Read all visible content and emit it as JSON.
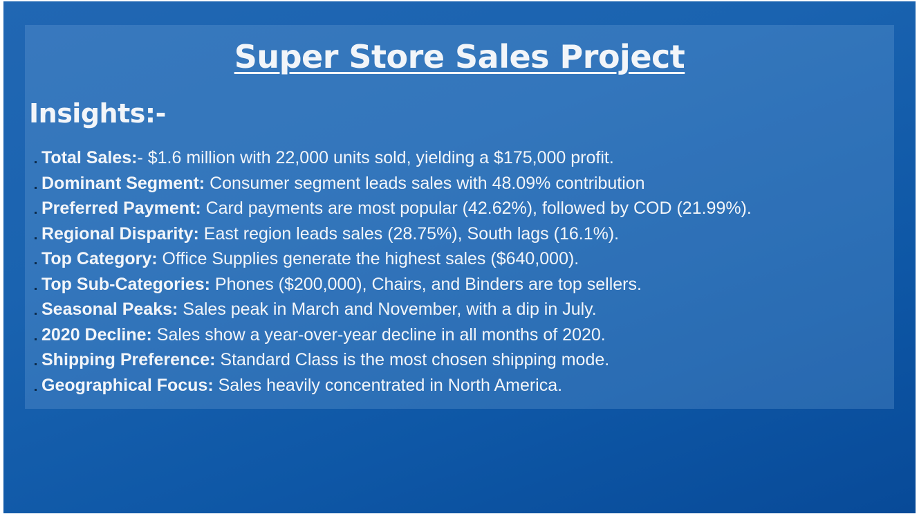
{
  "page": {
    "title": "Super Store Sales Project",
    "subtitle": "Insights:-"
  },
  "insights": [
    {
      "label": "Total Sales:",
      "text": "- $1.6 million with 22,000 units sold, yielding a $175,000 profit."
    },
    {
      "label": "Dominant Segment:",
      "text": " Consumer segment leads sales with 48.09% contribution"
    },
    {
      "label": "Preferred Payment:",
      "text": " Card payments are most popular (42.62%), followed by COD (21.99%)."
    },
    {
      "label": "Regional Disparity:",
      "text": " East region leads sales (28.75%), South lags (16.1%)."
    },
    {
      "label": "Top Category:",
      "text": " Office Supplies generate the highest sales ($640,000)."
    },
    {
      "label": "Top Sub-Categories:",
      "text": " Phones ($200,000), Chairs, and Binders are top sellers."
    },
    {
      "label": "Seasonal Peaks:",
      "text": " Sales peak in March and November, with a dip in July."
    },
    {
      "label": "2020 Decline:",
      "text": " Sales show a year-over-year decline in all months of 2020."
    },
    {
      "label": "Shipping Preference:",
      "text": " Standard Class is the most chosen shipping mode."
    },
    {
      "label": "Geographical Focus:",
      "text": " Sales heavily concentrated in North America."
    }
  ],
  "colors": {
    "background": "#1a63b0",
    "panel": "#4a86c4",
    "text": "#f2f5f9"
  }
}
